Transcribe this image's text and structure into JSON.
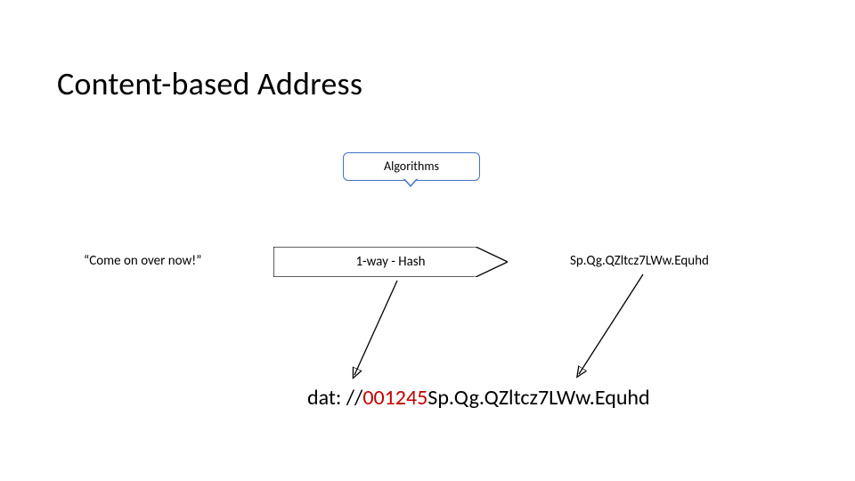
{
  "title": "Content-based Address",
  "callout": {
    "label": "Algorithms"
  },
  "input": "“Come on over now!”",
  "process": "1-way - Hash",
  "output": "Sp.Qg.QZltcz7LWw.Equhd",
  "result": {
    "scheme": "dat: //",
    "prefix": "001245",
    "rest": "Sp.Qg.QZltcz7LWw.Equhd"
  },
  "colors": {
    "accent": "#4472C4",
    "highlight": "#C00000",
    "stroke": "#000000"
  }
}
